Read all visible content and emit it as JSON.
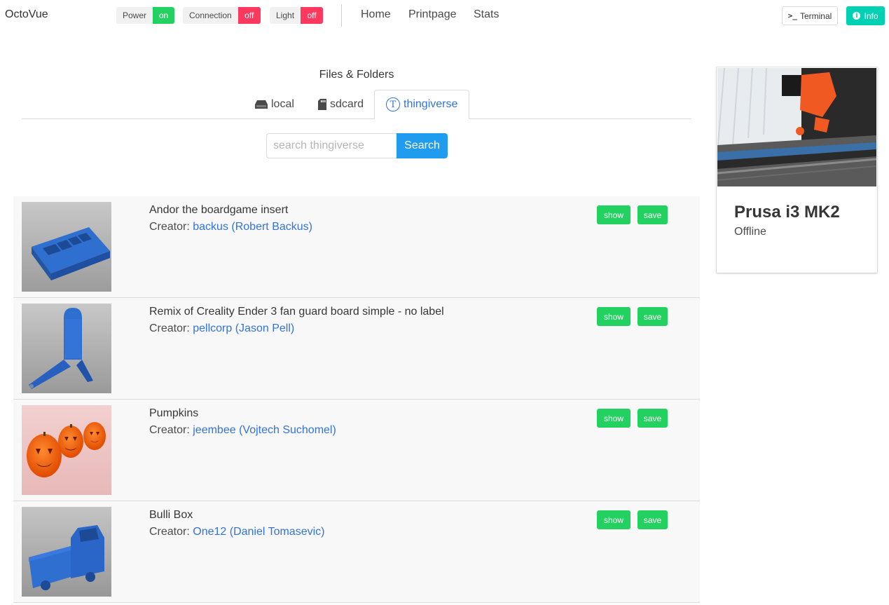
{
  "app": {
    "brand": "OctoVue"
  },
  "toggles": [
    {
      "label": "Power",
      "value": "on",
      "state": "on"
    },
    {
      "label": "Connection",
      "value": "off",
      "state": "off"
    },
    {
      "label": "Light",
      "value": "off",
      "state": "off"
    }
  ],
  "nav": {
    "home": "Home",
    "printpage": "Printpage",
    "stats": "Stats"
  },
  "actions": {
    "terminal": "Terminal",
    "terminal_icon_glyph": ">_",
    "info": "Info",
    "info_icon_glyph": "i"
  },
  "files": {
    "title": "Files & Folders",
    "tabs": [
      {
        "label": "local",
        "icon": "hard-drive-icon"
      },
      {
        "label": "sdcard",
        "icon": "sd-card-icon"
      },
      {
        "label": "thingiverse",
        "icon": "thingiverse-icon",
        "icon_glyph": "T",
        "active": true
      }
    ]
  },
  "search": {
    "placeholder": "search thingiverse",
    "value": "",
    "button": "Search"
  },
  "results": [
    {
      "title": "Andor the boardgame insert",
      "creator_label": "Creator:",
      "creator": "backus (Robert Backus)",
      "show": "show",
      "save": "save"
    },
    {
      "title": "Remix of Creality Ender 3 fan guard board simple - no label",
      "creator_label": "Creator:",
      "creator": "pellcorp (Jason Pell)",
      "show": "show",
      "save": "save"
    },
    {
      "title": "Pumpkins",
      "creator_label": "Creator:",
      "creator": "jeembee (Vojtech Suchomel)",
      "show": "show",
      "save": "save"
    },
    {
      "title": "Bulli Box",
      "creator_label": "Creator:",
      "creator": "One12 (Daniel Tomasevic)",
      "show": "show",
      "save": "save"
    }
  ],
  "printer": {
    "name": "Prusa i3 MK2",
    "status": "Offline"
  },
  "colors": {
    "on": "#23d160",
    "off": "#ff3860",
    "link": "#3273dc",
    "search": "#209cee",
    "info": "#00d1b2"
  }
}
